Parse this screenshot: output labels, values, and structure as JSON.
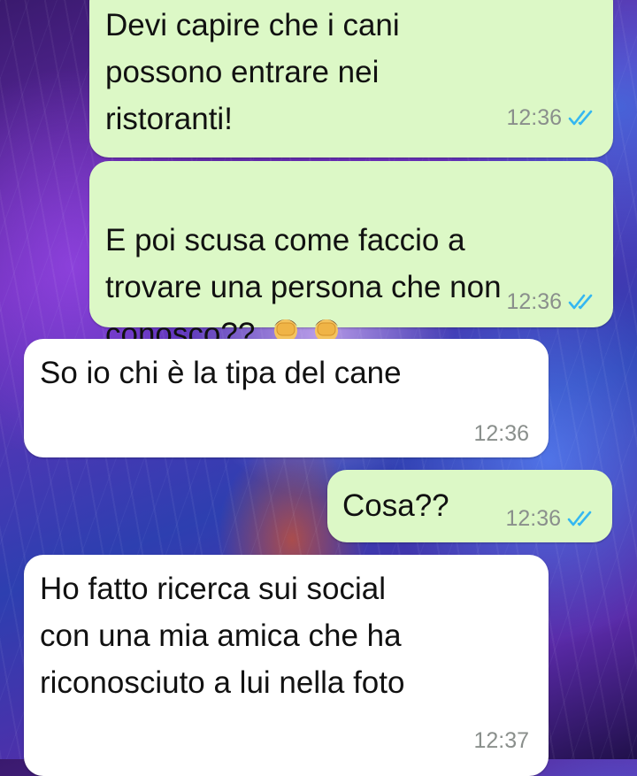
{
  "colors": {
    "outgoing_bubble": "#dcf8c6",
    "incoming_bubble": "#ffffff",
    "read_ticks": "#34b7f1",
    "timestamp": "#8a8f8c"
  },
  "messages": [
    {
      "direction": "outgoing",
      "text": "Devi capire che i cani\npossono entrare nei\nristoranti!",
      "time": "12:36",
      "status": "read-double-tick-icon"
    },
    {
      "direction": "outgoing",
      "text_before_emoji": "E poi scusa come faccio a\ntrovare una persona che non\nconosco?? ",
      "emoji": [
        "face-palm-emoji",
        "face-palm-emoji"
      ],
      "time": "12:36",
      "status": "read-double-tick-icon"
    },
    {
      "direction": "incoming",
      "text": "So io chi è la tipa del cane",
      "time": "12:36"
    },
    {
      "direction": "outgoing",
      "text": "Cosa??",
      "time": "12:36",
      "status": "read-double-tick-icon"
    },
    {
      "direction": "incoming",
      "text": "Ho fatto ricerca sui social\ncon una mia amica che ha\nriconosciuto a lui nella foto",
      "time": "12:37"
    }
  ]
}
